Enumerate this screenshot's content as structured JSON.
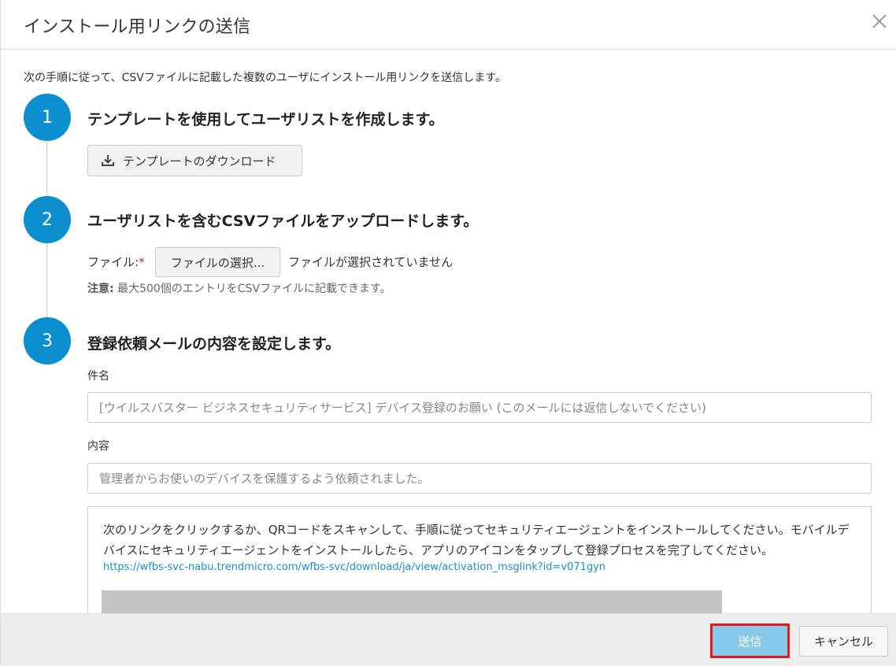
{
  "dialog": {
    "title": "インストール用リンクの送信",
    "intro": "次の手順に従って、CSVファイルに記載した複数のユーザにインストール用リンクを送信します。"
  },
  "steps": [
    {
      "number": "1",
      "title": "テンプレートを使用してユーザリストを作成します。",
      "download_label": "テンプレートのダウンロード"
    },
    {
      "number": "2",
      "title": "ユーザリストを含むCSVファイルをアップロードします。",
      "file_label": "ファイル:",
      "required_mark": "*",
      "choose_file_label": "ファイルの選択...",
      "file_status": "ファイルが選択されていません",
      "note_label": "注意:",
      "note_text": " 最大500個のエントリをCSVファイルに記載できます。"
    },
    {
      "number": "3",
      "title": "登録依頼メールの内容を設定します。",
      "subject_label": "件名",
      "subject_placeholder": "[ウイルスバスター ビジネスセキュリティサービス] デバイス登録のお願い (このメールには返信しないでください)",
      "content_label": "内容",
      "content_placeholder": "管理者からお使いのデバイスを保護するよう依頼されました。",
      "body_text": "次のリンクをクリックするか、QRコードをスキャンして、手順に従ってセキュリティエージェントをインストールしてください。モバイルデバイスにセキュリティエージェントをインストールしたら、アプリのアイコンをタップして登録プロセスを完了してください。",
      "body_link": "https://wfbs-svc-nabu.trendmicro.com/wfbs-svc/download/ja/view/activation_msglink?id=v071gyn"
    }
  ],
  "footer": {
    "send_label": "送信",
    "cancel_label": "キャンセル"
  },
  "colors": {
    "accent": "#0b8fcf",
    "send_button": "#86c9ea",
    "highlight": "#e3191e"
  }
}
